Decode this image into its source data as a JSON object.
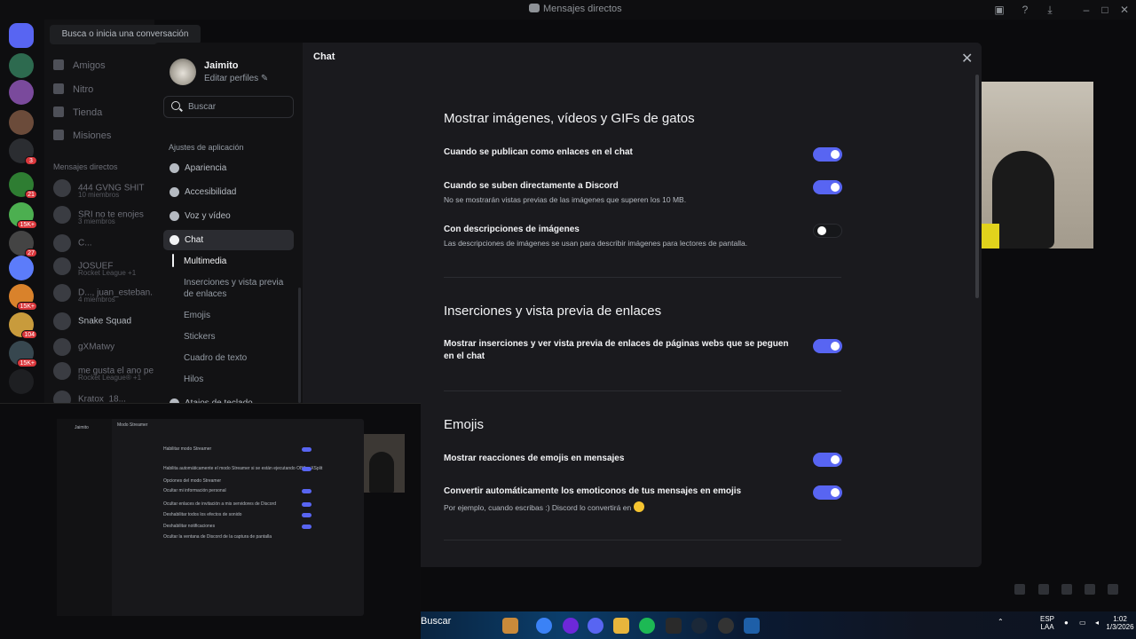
{
  "window": {
    "title": "Mensajes directos"
  },
  "dm_sidebar": {
    "search_placeholder": "Busca o inicia una conversación",
    "nav": [
      "Amigos",
      "Nitro",
      "Tienda",
      "Misiones"
    ],
    "section": "Mensajes directos",
    "dms": [
      {
        "name": "444 GVNG SHIT",
        "sub": "10 miembros"
      },
      {
        "name": "SRI no te enojes",
        "sub": "3 miembros"
      },
      {
        "name": "C...",
        "sub": ""
      },
      {
        "name": "JOSUEF",
        "sub": "Rocket League +1"
      },
      {
        "name": "D..., juan_esteban...",
        "sub": "4 miembros"
      },
      {
        "name": "Snake Squad",
        "sub": ""
      },
      {
        "name": "gXMatwy",
        "sub": ""
      },
      {
        "name": "me gusta el ano pe...",
        "sub": "Rocket League® +1"
      },
      {
        "name": "Kratox_18...",
        "sub": ""
      }
    ],
    "server_badges": [
      "3",
      "21",
      "15K+",
      "27",
      "15K+",
      "104",
      "15K+"
    ]
  },
  "modal": {
    "user": {
      "name": "Jaimito",
      "edit": "Editar perfiles ✎"
    },
    "search_placeholder": "Buscar",
    "section_label": "Ajustes de aplicación",
    "nav": [
      {
        "label": "Apariencia",
        "icon": "palette-icon"
      },
      {
        "label": "Accesibilidad",
        "icon": "accessibility-icon"
      },
      {
        "label": "Voz y vídeo",
        "icon": "microphone-icon"
      },
      {
        "label": "Chat",
        "icon": "chat-bubble-icon",
        "active": true
      }
    ],
    "subnav": [
      "Multimedia",
      "Inserciones y vista previa de enlaces",
      "Emojis",
      "Stickers",
      "Cuadro de texto",
      "Hilos"
    ],
    "next_nav": "Atajos de teclado",
    "content_title": "Chat",
    "sections": {
      "media": {
        "title": "Mostrar imágenes, vídeos y GIFs de gatos",
        "rows": [
          {
            "label": "Cuando se publican como enlaces en el chat",
            "desc": "",
            "on": true
          },
          {
            "label": "Cuando se suben directamente a Discord",
            "desc": "No se mostrarán vistas previas de las imágenes que superen los 10 MB.",
            "on": true
          },
          {
            "label": "Con descripciones de imágenes",
            "desc": "Las descripciones de imágenes se usan para describir imágenes para lectores de pantalla.",
            "on": false
          }
        ]
      },
      "embeds": {
        "title": "Inserciones y vista previa de enlaces",
        "rows": [
          {
            "label": "Mostrar inserciones y ver vista previa de enlaces de páginas webs que se peguen en el chat",
            "on": true
          }
        ]
      },
      "emojis": {
        "title": "Emojis",
        "rows": [
          {
            "label": "Mostrar reacciones de emojis en mensajes",
            "desc": "",
            "on": true
          },
          {
            "label": "Convertir automáticamente los emoticonos de tus mensajes en emojis",
            "desc": "Por ejemplo, cuando escribas :) Discord lo convertirá en",
            "on": true
          }
        ]
      }
    }
  },
  "thumbnail": {
    "title": "Modo Streamer",
    "user": "Jaimito",
    "rows": [
      "Habilitar modo Streamer",
      "Habilita automáticamente el modo Streamer si se están ejecutando OBS o XSplit",
      "Opciones del modo Streamer",
      "Ocultar mi información personal",
      "Ocultar enlaces de invitación a mis servidores de Discord",
      "Deshabilitar todos los efectos de sonido",
      "Deshabilitar notificaciones",
      "Ocultar la ventana de Discord de la captura de pantalla"
    ]
  },
  "taskbar": {
    "search": "Buscar",
    "lang": "ESP",
    "layout": "LAA",
    "time": "1:02",
    "date": "1/3/2026"
  }
}
